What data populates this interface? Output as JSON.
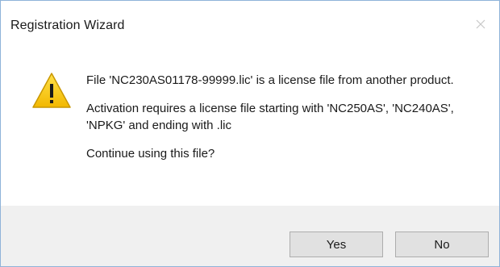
{
  "window": {
    "title": "Registration Wizard",
    "close_icon": "close-icon"
  },
  "message": {
    "icon": "warning-icon",
    "line1": "File 'NC230AS01178-99999.lic' is a license file from another product.",
    "line2": "Activation requires a license file starting with 'NC250AS', 'NC240AS', 'NPKG' and ending with .lic",
    "line3": "Continue using this file?"
  },
  "buttons": {
    "yes_label": "Yes",
    "no_label": "No"
  },
  "colors": {
    "footer_bg": "#f0f0f0",
    "warning_yellow": "#f6c700",
    "border": "#8fb3d9"
  }
}
